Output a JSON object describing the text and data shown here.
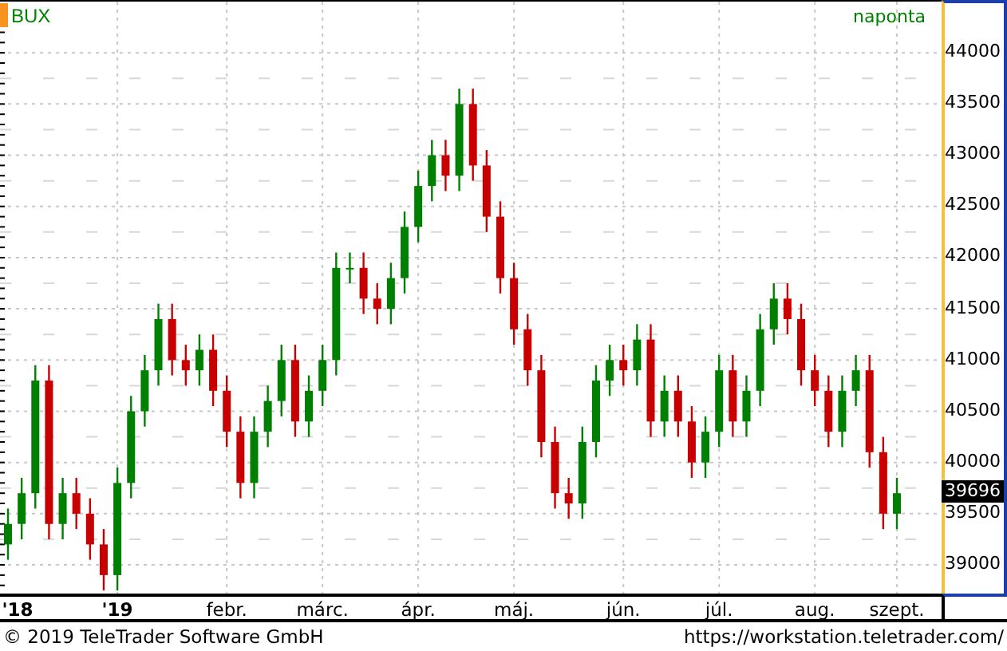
{
  "chart": {
    "symbol": "BUX",
    "interval": "naponta",
    "last_value": "39696",
    "chart_data": {
      "type": "candlestick",
      "grid": true,
      "ylim": [
        38720,
        44500
      ],
      "yticks": [
        39000,
        39500,
        40000,
        40500,
        41000,
        41500,
        42000,
        42500,
        43000,
        43500,
        44000
      ],
      "categories": [
        "'18",
        null,
        null,
        null,
        null,
        null,
        null,
        null,
        "'19",
        null,
        null,
        null,
        null,
        null,
        null,
        null,
        "febr.",
        null,
        null,
        null,
        null,
        null,
        null,
        "márc.",
        null,
        null,
        null,
        null,
        null,
        null,
        "ápr.",
        null,
        null,
        null,
        null,
        null,
        null,
        "máj.",
        null,
        null,
        null,
        null,
        null,
        null,
        null,
        "jún.",
        null,
        null,
        null,
        null,
        null,
        null,
        "júl.",
        null,
        null,
        null,
        null,
        null,
        null,
        "aug.",
        null,
        null,
        null,
        null,
        null,
        "szept."
      ],
      "ohlc": [
        [
          39200,
          39550,
          39050,
          39400
        ],
        [
          39400,
          39850,
          39250,
          39700
        ],
        [
          39700,
          40950,
          39550,
          40800
        ],
        [
          40800,
          40950,
          39250,
          39400
        ],
        [
          39400,
          39850,
          39250,
          39700
        ],
        [
          39700,
          39850,
          39350,
          39500
        ],
        [
          39500,
          39650,
          39050,
          39200
        ],
        [
          39200,
          39350,
          38750,
          38900
        ],
        [
          38900,
          39950,
          38750,
          39800
        ],
        [
          39800,
          40650,
          39650,
          40500
        ],
        [
          40500,
          41050,
          40350,
          40900
        ],
        [
          40900,
          41550,
          40750,
          41400
        ],
        [
          41400,
          41550,
          40850,
          41000
        ],
        [
          41000,
          41150,
          40750,
          40900
        ],
        [
          40900,
          41250,
          40750,
          41100
        ],
        [
          41100,
          41250,
          40550,
          40700
        ],
        [
          40700,
          40850,
          40150,
          40300
        ],
        [
          40300,
          40450,
          39650,
          39800
        ],
        [
          39800,
          40450,
          39650,
          40300
        ],
        [
          40300,
          40750,
          40150,
          40600
        ],
        [
          40600,
          41150,
          40450,
          41000
        ],
        [
          41000,
          41150,
          40250,
          40400
        ],
        [
          40400,
          40850,
          40250,
          40700
        ],
        [
          40700,
          41150,
          40550,
          41000
        ],
        [
          41000,
          42050,
          40850,
          41900
        ],
        [
          41900,
          42050,
          41750,
          41900
        ],
        [
          41900,
          42050,
          41450,
          41600
        ],
        [
          41600,
          41750,
          41350,
          41500
        ],
        [
          41500,
          41950,
          41350,
          41800
        ],
        [
          41800,
          42450,
          41650,
          42300
        ],
        [
          42300,
          42850,
          42150,
          42700
        ],
        [
          42700,
          43150,
          42550,
          43000
        ],
        [
          43000,
          43150,
          42650,
          42800
        ],
        [
          42800,
          43650,
          42650,
          43500
        ],
        [
          43500,
          43650,
          42750,
          42900
        ],
        [
          42900,
          43050,
          42250,
          42400
        ],
        [
          42400,
          42550,
          41650,
          41800
        ],
        [
          41800,
          41950,
          41150,
          41300
        ],
        [
          41300,
          41450,
          40750,
          40900
        ],
        [
          40900,
          41050,
          40050,
          40200
        ],
        [
          40200,
          40350,
          39550,
          39700
        ],
        [
          39700,
          39850,
          39450,
          39600
        ],
        [
          39600,
          40350,
          39450,
          40200
        ],
        [
          40200,
          40950,
          40050,
          40800
        ],
        [
          40800,
          41150,
          40650,
          41000
        ],
        [
          41000,
          41150,
          40750,
          40900
        ],
        [
          40900,
          41350,
          40750,
          41200
        ],
        [
          41200,
          41350,
          40250,
          40400
        ],
        [
          40400,
          40850,
          40250,
          40700
        ],
        [
          40700,
          40850,
          40250,
          40400
        ],
        [
          40400,
          40550,
          39850,
          40000
        ],
        [
          40000,
          40450,
          39850,
          40300
        ],
        [
          40300,
          41050,
          40150,
          40900
        ],
        [
          40900,
          41050,
          40250,
          40400
        ],
        [
          40400,
          40850,
          40250,
          40700
        ],
        [
          40700,
          41450,
          40550,
          41300
        ],
        [
          41300,
          41750,
          41150,
          41600
        ],
        [
          41600,
          41750,
          41250,
          41400
        ],
        [
          41400,
          41550,
          40750,
          40900
        ],
        [
          40900,
          41050,
          40550,
          40700
        ],
        [
          40700,
          40850,
          40150,
          40300
        ],
        [
          40300,
          40850,
          40150,
          40700
        ],
        [
          40700,
          41050,
          40550,
          40900
        ],
        [
          40900,
          41050,
          39950,
          40100
        ],
        [
          40100,
          40250,
          39350,
          39500
        ],
        [
          39500,
          39850,
          39350,
          39700
        ]
      ]
    }
  },
  "footer": {
    "copyright": "© 2019 TeleTrader Software GmbH",
    "url": "https://workstation.teletrader.com/"
  }
}
